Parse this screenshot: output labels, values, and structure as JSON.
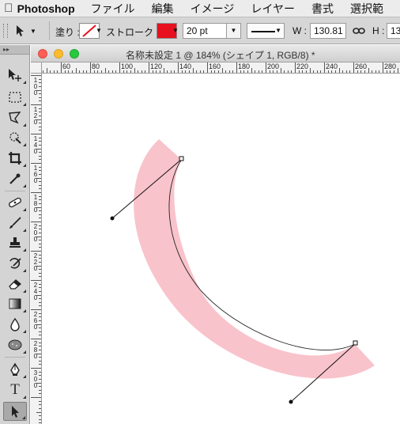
{
  "menubar": {
    "app": "Photoshop",
    "items": [
      "ファイル",
      "編集",
      "イメージ",
      "レイヤー",
      "書式",
      "選択範"
    ]
  },
  "options": {
    "fill_label": "塗り :",
    "stroke_label": "ストローク :",
    "stroke_color": "#e8101e",
    "stroke_width": "20 pt",
    "w_label": "W :",
    "w_value": "130.81",
    "h_label": "H :",
    "h_value": "13"
  },
  "document": {
    "title": "名称未設定 1 @ 184% (シェイプ 1, RGB/8) *"
  },
  "ruler": {
    "h_labels": [
      "60",
      "80",
      "100",
      "120",
      "140",
      "160",
      "180",
      "200",
      "220",
      "240",
      "260",
      "280"
    ],
    "v_labels": [
      "100",
      "120",
      "140",
      "160",
      "180",
      "200",
      "220",
      "240",
      "260",
      "280",
      "300"
    ]
  },
  "shape": {
    "stroke_color": "#f9c3cb"
  },
  "icons": {
    "apple": "apple-icon",
    "tools": [
      "move-tool-icon",
      "marquee-tool-icon",
      "lasso-tool-icon",
      "quick-selection-tool-icon",
      "crop-tool-icon",
      "eyedropper-tool-icon",
      "spot-healing-brush-icon",
      "brush-tool-icon",
      "clone-stamp-icon",
      "history-brush-icon",
      "eraser-tool-icon",
      "gradient-tool-icon",
      "blur-tool-icon",
      "dodge-tool-icon",
      "pen-tool-icon",
      "type-tool-icon",
      "path-selection-tool-icon"
    ]
  }
}
